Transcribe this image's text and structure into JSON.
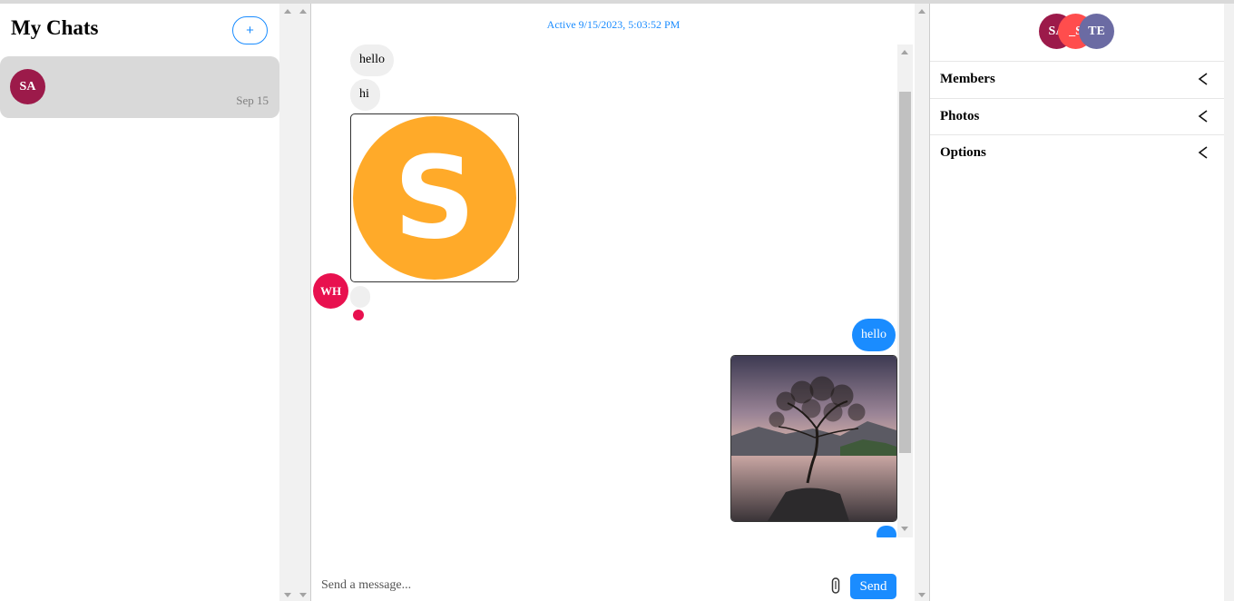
{
  "sidebar": {
    "title": "My Chats",
    "new_chat_label": "+",
    "chats": [
      {
        "avatar_initials": "SA",
        "avatar_color": "#9c1a4a",
        "date": "Sep 15"
      }
    ]
  },
  "conversation": {
    "active_status": "Active 9/15/2023, 5:03:52 PM",
    "messages": [
      {
        "type": "text",
        "direction": "incoming",
        "text": "hello"
      },
      {
        "type": "text",
        "direction": "incoming",
        "text": "hi"
      },
      {
        "type": "image",
        "direction": "incoming",
        "image_desc": "orange circle logo with white S",
        "logo_letter": "S",
        "color": "#ffaa29"
      },
      {
        "type": "text",
        "direction": "incoming",
        "text": "",
        "sender_initials": "WH",
        "sender_color": "#e8114f"
      },
      {
        "type": "text",
        "direction": "outgoing",
        "text": "hello"
      },
      {
        "type": "image",
        "direction": "outgoing",
        "image_desc": "lone tree in lake at dusk"
      }
    ],
    "composer": {
      "placeholder": "Send a message...",
      "send_label": "Send",
      "attach_icon": "paperclip-icon"
    }
  },
  "details": {
    "members": [
      {
        "initials": "SA",
        "color": "#9c1a4a"
      },
      {
        "initials": "_S",
        "color": "#ff4d4d"
      },
      {
        "initials": "TE",
        "color": "#6b6ba3"
      }
    ],
    "sections": [
      {
        "label": "Members",
        "icon": "chevron-left-icon"
      },
      {
        "label": "Photos",
        "icon": "chevron-left-icon"
      },
      {
        "label": "Options",
        "icon": "chevron-left-icon"
      }
    ]
  },
  "colors": {
    "accent": "#1a8cff",
    "typing_dot": "#e8114f"
  }
}
